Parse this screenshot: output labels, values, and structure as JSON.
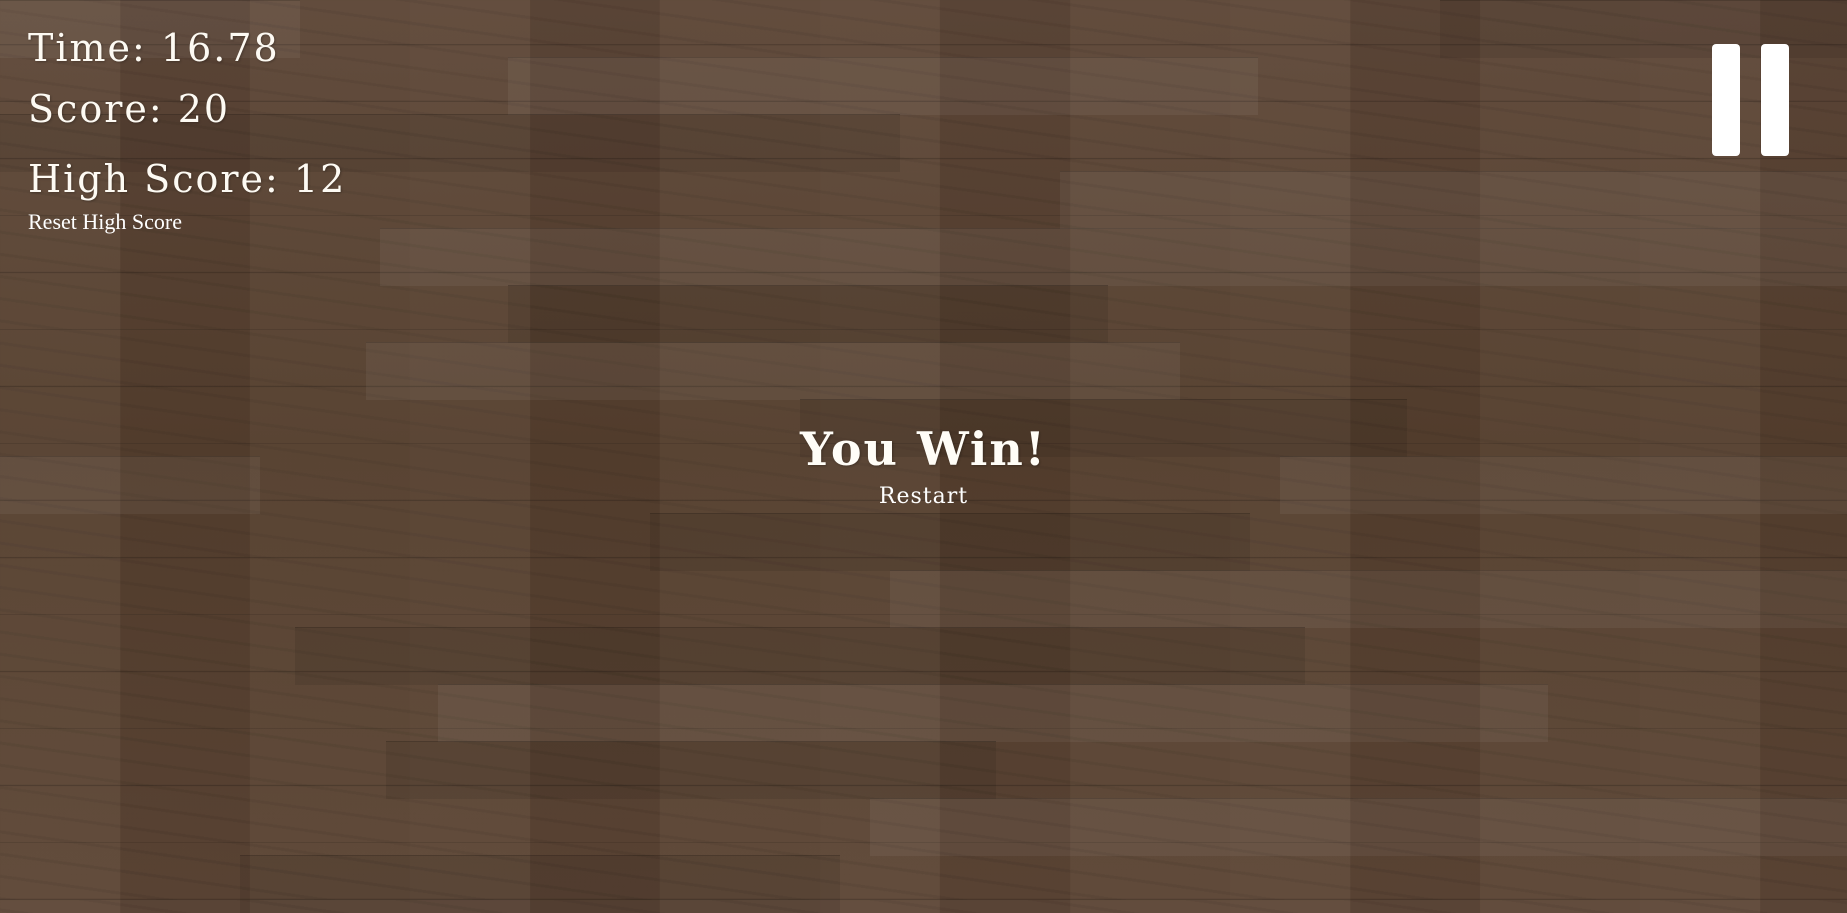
{
  "hud": {
    "time_text": "Time: 16.78",
    "score_text": "Score: 20",
    "high_score_text": "High Score: 12",
    "reset_label": "Reset High Score"
  },
  "overlay": {
    "title": "You Win!",
    "restart_label": "Restart"
  },
  "controls": {
    "pause_icon": "pause-icon"
  },
  "colors": {
    "text": "#ffffff",
    "background": "#5b4537"
  }
}
